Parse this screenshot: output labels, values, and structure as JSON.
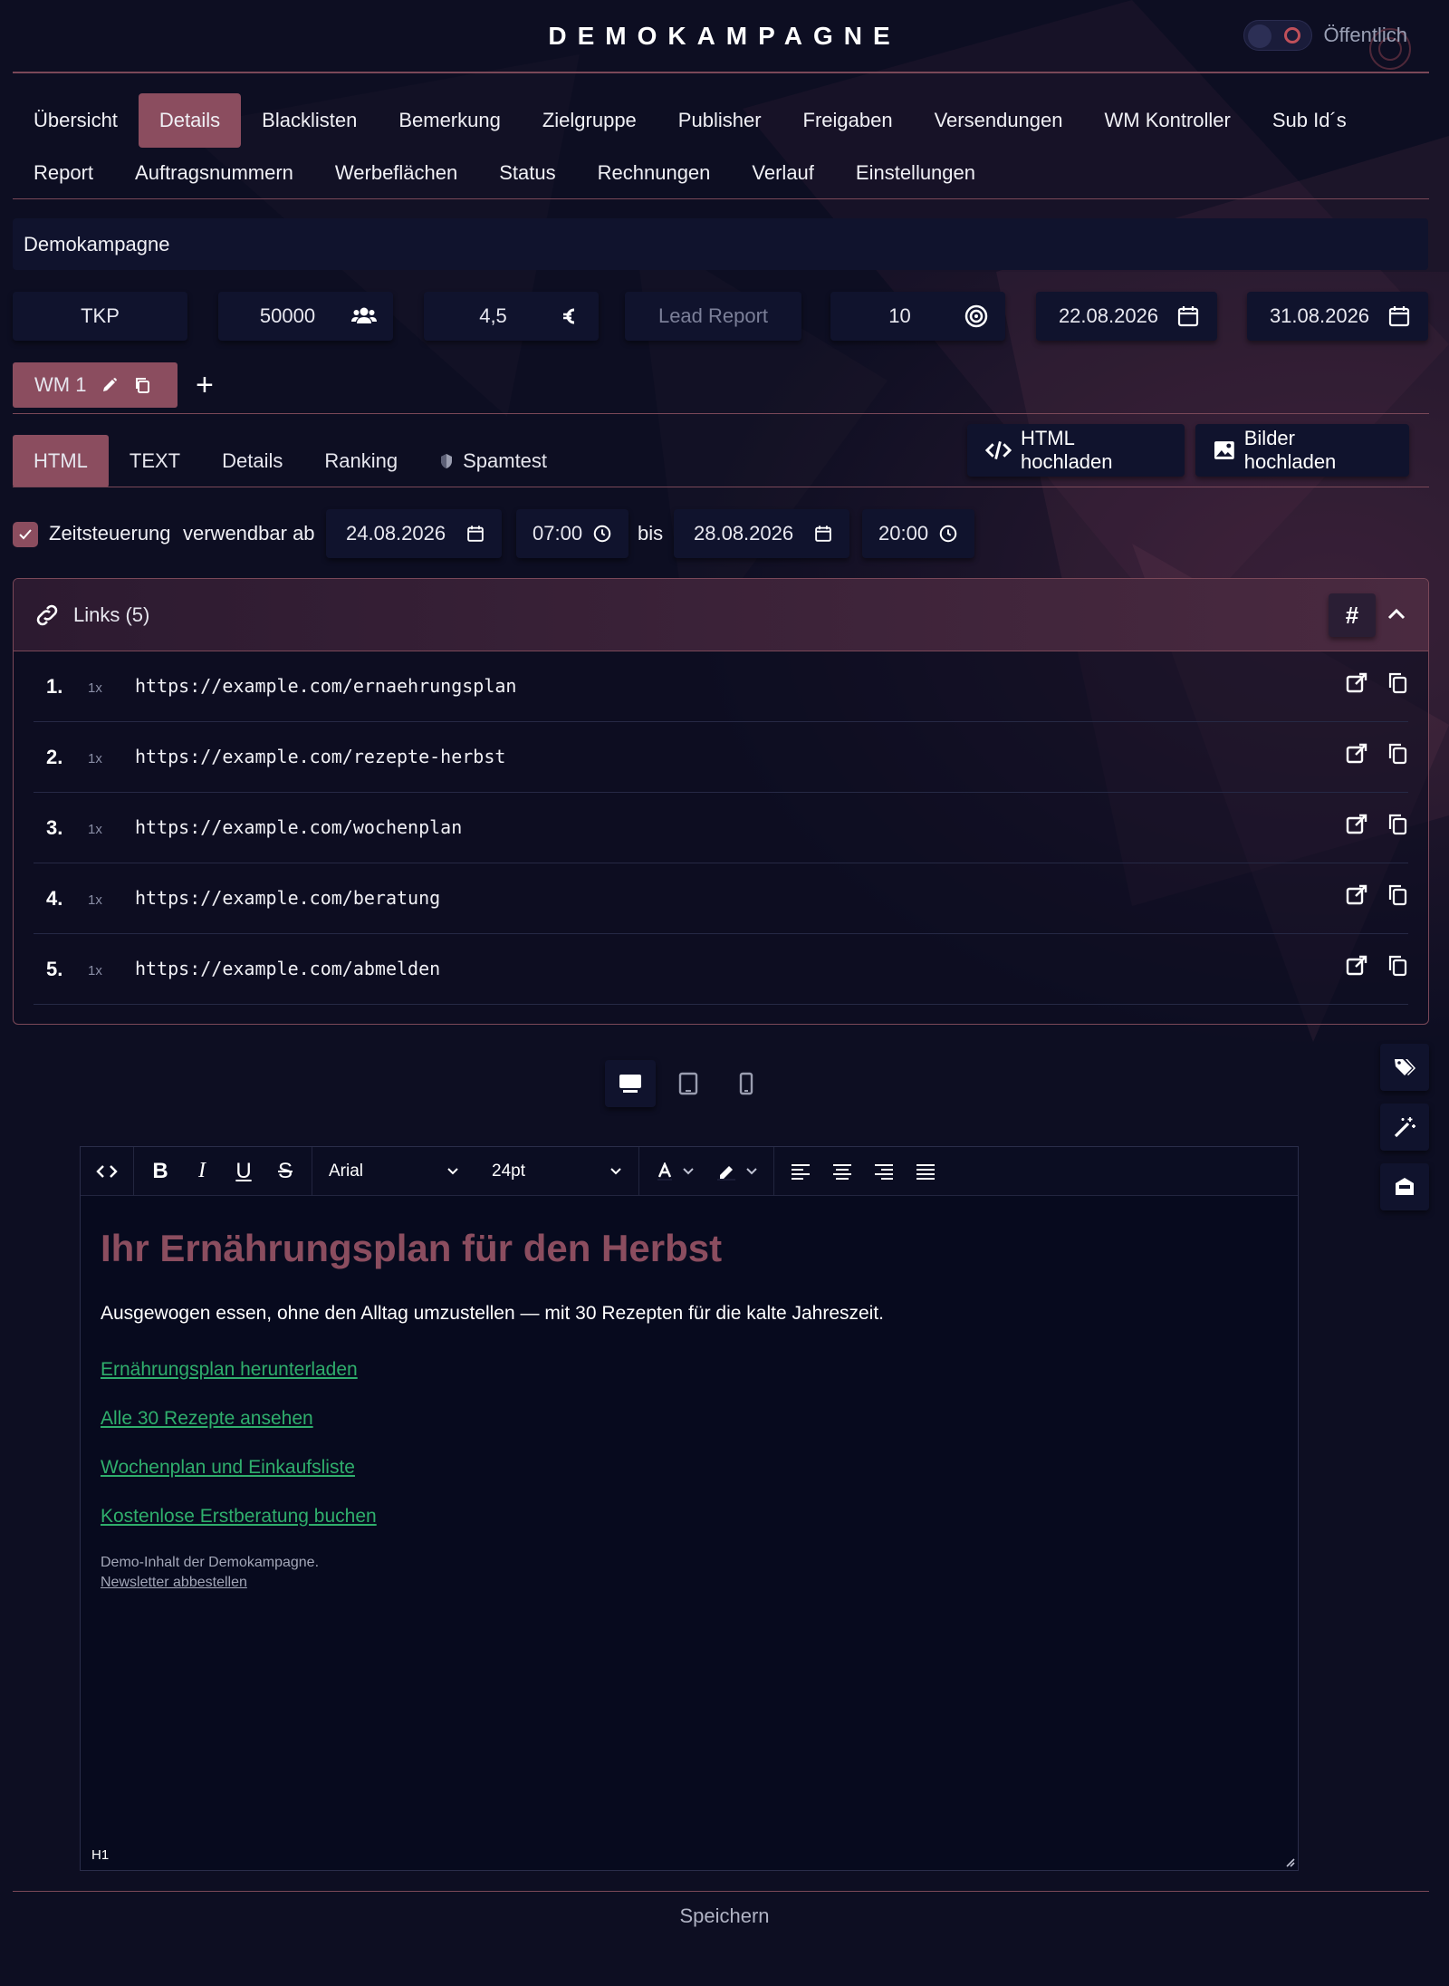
{
  "header": {
    "title": "DEMOKAMPAGNE",
    "public_label": "Öffentlich"
  },
  "nav": {
    "row1": [
      "Übersicht",
      "Details",
      "Blacklisten",
      "Bemerkung",
      "Zielgruppe",
      "Publisher",
      "Freigaben",
      "Versendungen",
      "WM Kontroller",
      "Sub Id´s"
    ],
    "row2": [
      "Report",
      "Auftragsnummern",
      "Werbeflächen",
      "Status",
      "Rechnungen",
      "Verlauf",
      "Einstellungen"
    ],
    "active": "Details"
  },
  "campaign": {
    "name": "Demokampagne"
  },
  "metrics": {
    "billing_model": "TKP",
    "volume": "50000",
    "price": "4,5",
    "lead_report_placeholder": "Lead Report",
    "target": "10",
    "start_date": "22.08.2026",
    "end_date": "31.08.2026"
  },
  "wm": {
    "tab_label": "WM 1"
  },
  "content_tabs": {
    "items": [
      "HTML",
      "TEXT",
      "Details",
      "Ranking",
      "Spamtest"
    ],
    "active": "HTML",
    "html_upload": "HTML hochladen",
    "images_upload": "Bilder hochladen"
  },
  "scheduling": {
    "checkbox_label": "Zeitsteuerung",
    "usable_from": "verwendbar ab",
    "from_date": "24.08.2026",
    "from_time": "07:00",
    "until": "bis",
    "to_date": "28.08.2026",
    "to_time": "20:00"
  },
  "links": {
    "title": "Links (5)",
    "hash": "#",
    "items": [
      {
        "num": "1.",
        "count": "1x",
        "url": "https://example.com/ernaehrungsplan"
      },
      {
        "num": "2.",
        "count": "1x",
        "url": "https://example.com/rezepte-herbst"
      },
      {
        "num": "3.",
        "count": "1x",
        "url": "https://example.com/wochenplan"
      },
      {
        "num": "4.",
        "count": "1x",
        "url": "https://example.com/beratung"
      },
      {
        "num": "5.",
        "count": "1x",
        "url": "https://example.com/abmelden"
      }
    ]
  },
  "editor": {
    "font": "Arial",
    "size": "24pt",
    "heading": "Ihr Ernährungsplan für den Herbst",
    "paragraph": "Ausgewogen essen, ohne den Alltag umzustellen — mit 30 Rezepten für die kalte Jahreszeit.",
    "links": [
      "Ernährungsplan herunterladen",
      "Alle 30 Rezepte ansehen",
      "Wochenplan und Einkaufsliste",
      "Kostenlose Erstberatung buchen"
    ],
    "footer": "Demo-Inhalt der Demokampagne.",
    "unsubscribe": "Newsletter abbestellen",
    "status": "H1",
    "heading_color": "#8b4d5f",
    "link_color": "#2fae6c"
  },
  "save_label": "Speichern",
  "colors": {
    "accent": "#8b4d5f",
    "background": "#0d0e22",
    "field": "#10132d"
  }
}
